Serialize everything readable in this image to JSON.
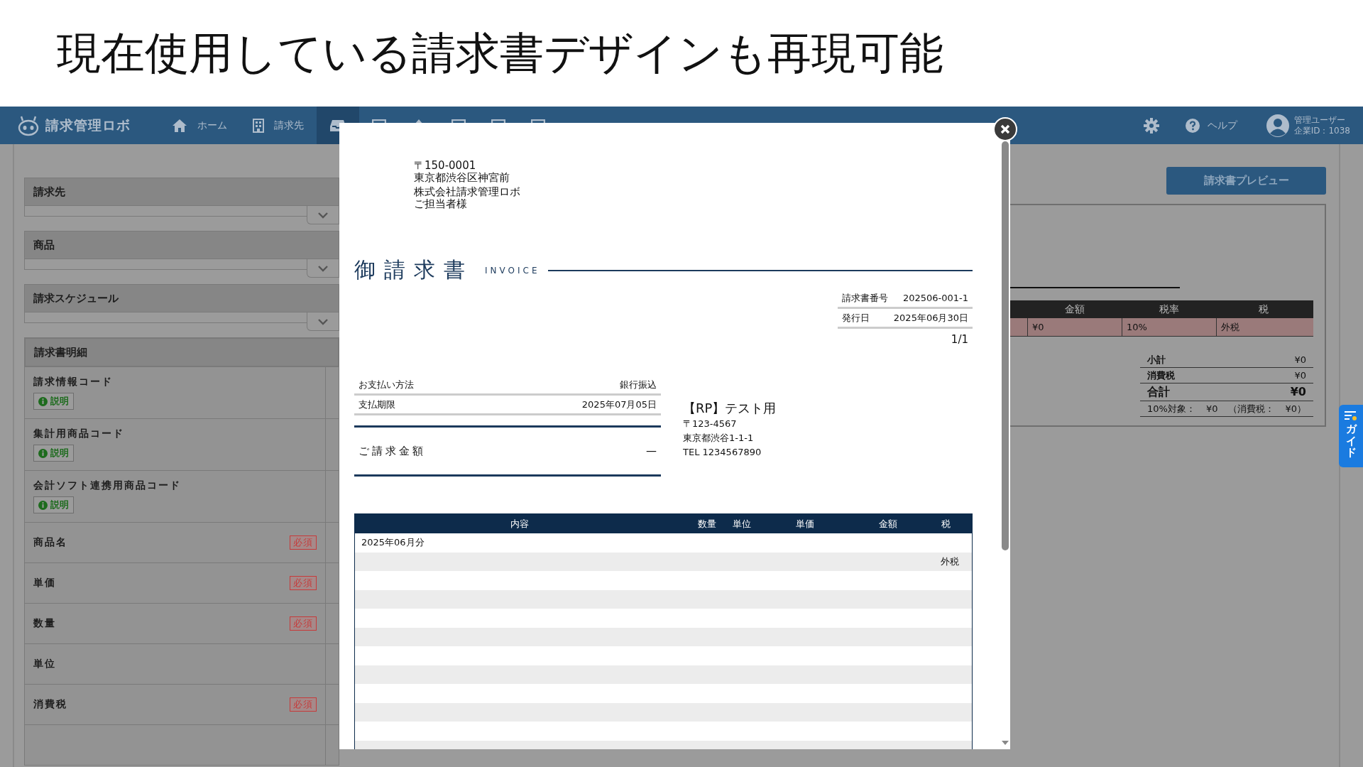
{
  "slide_title": "現在使用している請求書デザインも再現可能",
  "app": {
    "logo": "請求管理ロボ",
    "nav": [
      {
        "kind": "home",
        "label": "ホーム",
        "selected": false
      },
      {
        "kind": "building",
        "label": "請求先",
        "selected": false
      },
      {
        "kind": "inbox",
        "selected": true
      },
      {
        "kind": "doc"
      },
      {
        "kind": "upload"
      },
      {
        "kind": "doc"
      },
      {
        "kind": "doc"
      },
      {
        "kind": "doc"
      }
    ],
    "help": "ヘルプ",
    "user_name": "管理ユーザー",
    "company_id": "企業ID：1038"
  },
  "left_panel": {
    "sections": [
      {
        "title": "請求先",
        "expanded": false
      },
      {
        "title": "商品",
        "expanded": false
      },
      {
        "title": "請求スケジュール",
        "expanded": false
      }
    ],
    "detail_title": "請求書明細",
    "detail_rows": [
      {
        "label": "請求情報コード",
        "help": "説明"
      },
      {
        "label": "集計用商品コード",
        "help": "説明"
      },
      {
        "label": "会計ソフト連携用商品コード",
        "help": "説明"
      },
      {
        "label": "商品名",
        "required": "必須"
      },
      {
        "label": "単価",
        "required": "必須"
      },
      {
        "label": "数量",
        "required": "必須"
      },
      {
        "label": "単位"
      },
      {
        "label": "消費税",
        "required": "必須"
      },
      {}
    ]
  },
  "right_panel": {
    "preview_button": "請求書プレビュー",
    "table": {
      "columns": [
        "金額",
        "税率",
        "税"
      ],
      "row": [
        "¥0",
        "10%",
        "外税"
      ]
    },
    "summary": [
      {
        "kind": "normal",
        "label": "小計",
        "value": "¥0"
      },
      {
        "kind": "normal",
        "label": "消費税",
        "value": "¥0"
      },
      {
        "kind": "total",
        "label": "合計",
        "value": "¥0"
      }
    ],
    "tax_note": [
      "10%対象：",
      "¥0",
      "（消費税：",
      "¥0）"
    ]
  },
  "guide_tab": "ガイド",
  "invoice": {
    "address": [
      "〒150-0001",
      "東京都渋谷区神宮前",
      "株式会社請求管理ロボ",
      "ご担当者様"
    ],
    "title": "御請求書",
    "title_en": "INVOICE",
    "info": [
      {
        "label": "請求書番号",
        "value": "202506-001-1"
      },
      {
        "label": "発行日",
        "value": "2025年06月30日"
      }
    ],
    "page": "1/1",
    "payment": [
      {
        "label": "お支払い方法",
        "value": "銀行振込"
      },
      {
        "label": "支払期限",
        "value": "2025年07月05日"
      }
    ],
    "amount_label": "ご請求金額",
    "amount_value": "—",
    "issuer": {
      "name": "【RP】テスト用",
      "lines": [
        "〒123-4567",
        "東京都渋谷1-1-1",
        "TEL 1234567890"
      ]
    },
    "items": {
      "columns": [
        "内容",
        "数量",
        "単位",
        "単価",
        "金額",
        "税"
      ],
      "rows": [
        {
          "description": "2025年06月分"
        },
        {
          "tax": "外税"
        },
        {},
        {},
        {},
        {},
        {},
        {},
        {},
        {},
        {},
        {}
      ]
    }
  }
}
